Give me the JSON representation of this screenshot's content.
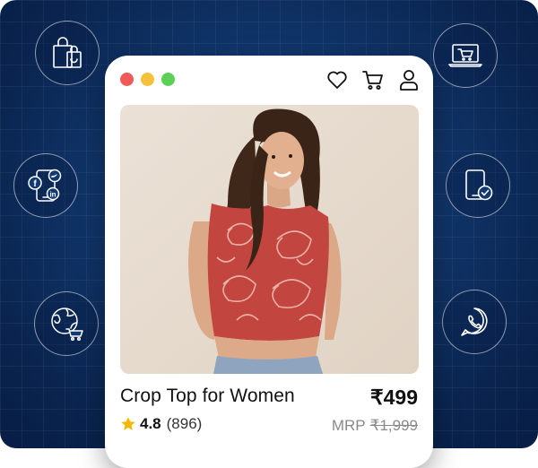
{
  "colors": {
    "window_dot_red": "#ef5a5a",
    "window_dot_yellow": "#f5c13b",
    "window_dot_green": "#5ccf57",
    "star": "#f5b800",
    "icon_stroke": "#ffffff"
  },
  "side_icons": [
    "shopping-bags-icon",
    "laptop-cart-icon",
    "phone-social-media-icon",
    "phone-check-icon",
    "globe-cart-icon",
    "whatsapp-icon"
  ],
  "header_icons": [
    "heart-icon",
    "cart-icon",
    "user-icon"
  ],
  "product": {
    "title": "Crop Top for Women",
    "price": "₹499",
    "rating": "4.8",
    "review_count": "(896)",
    "mrp_label": "MRP",
    "mrp_value": "₹1,999"
  }
}
